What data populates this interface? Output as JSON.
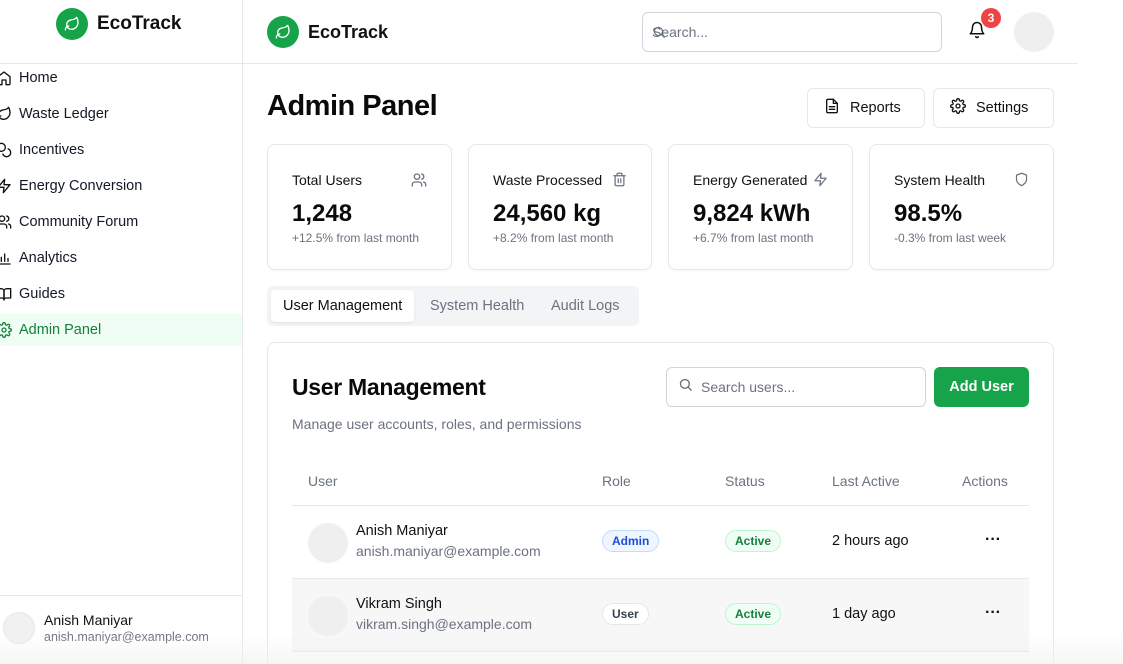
{
  "brand": {
    "name": "EcoTrack"
  },
  "sidebar": {
    "items": [
      {
        "label": "Home",
        "icon": "home-icon"
      },
      {
        "label": "Waste Ledger",
        "icon": "leaf-icon"
      },
      {
        "label": "Incentives",
        "icon": "coins-icon"
      },
      {
        "label": "Energy Conversion",
        "icon": "zap-icon"
      },
      {
        "label": "Community Forum",
        "icon": "users-icon"
      },
      {
        "label": "Analytics",
        "icon": "bar-chart-icon"
      },
      {
        "label": "Guides",
        "icon": "book-icon"
      },
      {
        "label": "Admin Panel",
        "icon": "gear-icon",
        "active": true
      }
    ],
    "user": {
      "name": "Anish Maniyar",
      "email": "anish.maniyar@example.com"
    }
  },
  "header": {
    "search_placeholder": "Search...",
    "notification_count": "3"
  },
  "page": {
    "title": "Admin Panel",
    "reports_label": "Reports",
    "settings_label": "Settings"
  },
  "stats": [
    {
      "title": "Total Users",
      "value": "1,248",
      "sub": "+12.5% from last month",
      "icon": "users-icon"
    },
    {
      "title": "Waste Processed",
      "value": "24,560 kg",
      "sub": "+8.2% from last month",
      "icon": "trash-icon"
    },
    {
      "title": "Energy Generated",
      "value": "9,824 kWh",
      "sub": "+6.7% from last month",
      "icon": "zap-icon"
    },
    {
      "title": "System Health",
      "value": "98.5%",
      "sub": "-0.3% from last week",
      "icon": "shield-icon"
    }
  ],
  "tabs": [
    {
      "label": "User Management",
      "active": true
    },
    {
      "label": "System Health"
    },
    {
      "label": "Audit Logs"
    }
  ],
  "user_management": {
    "title": "User Management",
    "description": "Manage user accounts, roles, and permissions",
    "search_placeholder": "Search users...",
    "add_label": "Add User",
    "columns": [
      "User",
      "Role",
      "Status",
      "Last Active",
      "Actions"
    ],
    "rows": [
      {
        "name": "Anish Maniyar",
        "email": "anish.maniyar@example.com",
        "role": "Admin",
        "status": "Active",
        "last_active": "2 hours ago",
        "actions": "···"
      },
      {
        "name": "Vikram Singh",
        "email": "vikram.singh@example.com",
        "role": "User",
        "status": "Active",
        "last_active": "1 day ago",
        "actions": "···"
      }
    ]
  },
  "colors": {
    "accent": "#16a34a",
    "badge": "#ef4444",
    "active_nav_bg": "#f0fdf4"
  }
}
